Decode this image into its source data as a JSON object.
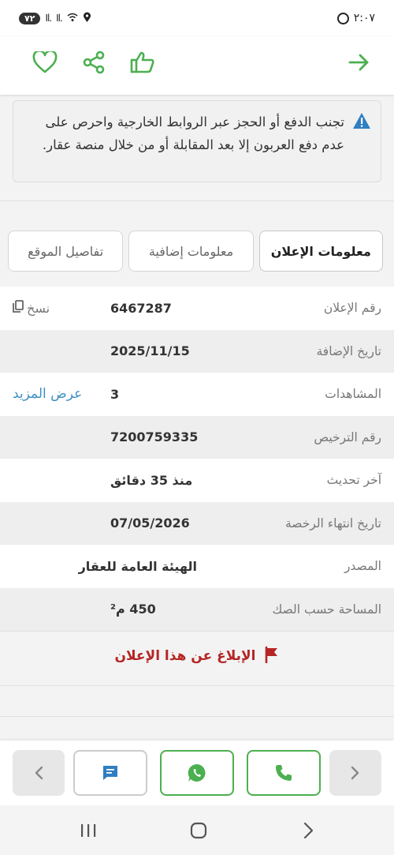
{
  "status_bar": {
    "time": "٢:٠٧",
    "battery": "٧٢",
    "signal_1": "Il.",
    "signal_2": "Il."
  },
  "top_bar": {
    "icons": [
      "arrow-right-icon",
      "like-icon",
      "share-icon",
      "heart-icon"
    ],
    "accent_color": "#4caf50"
  },
  "warning": {
    "text": "تجنب الدفع أو الحجز عبر الروابط الخارجية واحرص على عدم دفع العربون إلا بعد المقابلة أو من خلال منصة عقار."
  },
  "tabs": [
    {
      "label": "معلومات الإعلان",
      "active": true
    },
    {
      "label": "معلومات إضافية",
      "active": false
    },
    {
      "label": "تفاصيل الموقع",
      "active": false
    }
  ],
  "details": [
    {
      "label": "رقم الإعلان",
      "value": "6467287",
      "action": "نسخ"
    },
    {
      "label": "تاريخ الإضافة",
      "value": "2025/11/15"
    },
    {
      "label": "المشاهدات",
      "value": "3",
      "action": "عرض المزيد"
    },
    {
      "label": "رقم الترخيص",
      "value": "7200759335"
    },
    {
      "label": "آخر تحديث",
      "value": "منذ 35 دقائق"
    },
    {
      "label": "تاريخ انتهاء الرخصة",
      "value": "07/05/2026"
    },
    {
      "label": "المصدر",
      "value": "الهيئة العامة للعقار"
    },
    {
      "label": "المساحة حسب الصك",
      "value": "450 م²"
    }
  ],
  "report": {
    "label": "الإبلاغ عن هذا الإعلان",
    "color": "#b52525"
  },
  "bottom_actions": [
    "chevron-left-icon",
    "chat-icon",
    "whatsapp-icon",
    "phone-icon",
    "chevron-right-icon"
  ],
  "link_color": "#3f8fc4"
}
